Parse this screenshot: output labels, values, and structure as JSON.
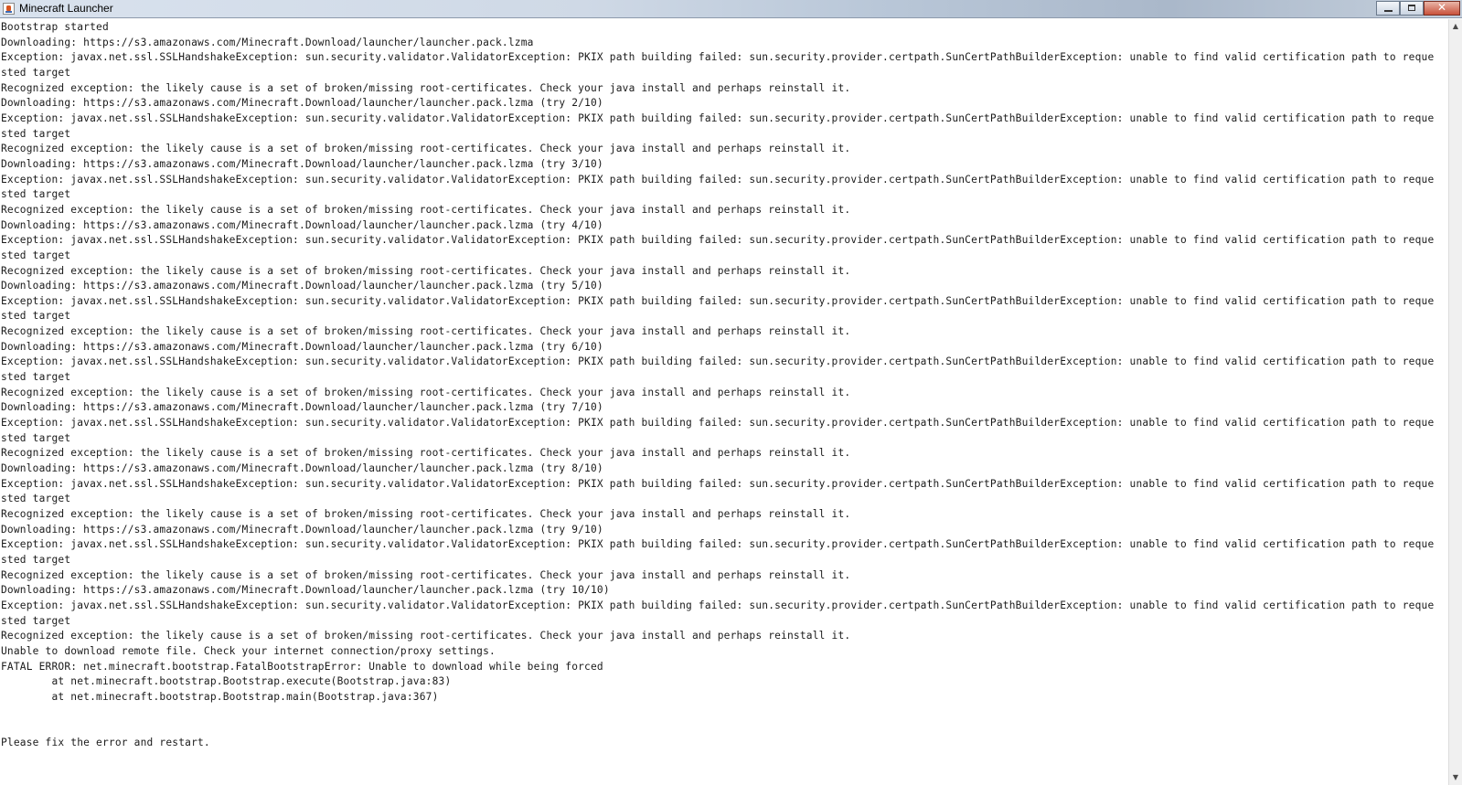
{
  "window": {
    "title": "Minecraft Launcher",
    "close_glyph": "✕"
  },
  "scrollbar": {
    "up_glyph": "▲",
    "down_glyph": "▼"
  },
  "log": {
    "lines": [
      "Bootstrap started",
      "Downloading: https://s3.amazonaws.com/Minecraft.Download/launcher/launcher.pack.lzma",
      "Exception: javax.net.ssl.SSLHandshakeException: sun.security.validator.ValidatorException: PKIX path building failed: sun.security.provider.certpath.SunCertPathBuilderException: unable to find valid certification path to reque",
      "sted target",
      "Recognized exception: the likely cause is a set of broken/missing root-certificates. Check your java install and perhaps reinstall it.",
      "Downloading: https://s3.amazonaws.com/Minecraft.Download/launcher/launcher.pack.lzma (try 2/10)",
      "Exception: javax.net.ssl.SSLHandshakeException: sun.security.validator.ValidatorException: PKIX path building failed: sun.security.provider.certpath.SunCertPathBuilderException: unable to find valid certification path to reque",
      "sted target",
      "Recognized exception: the likely cause is a set of broken/missing root-certificates. Check your java install and perhaps reinstall it.",
      "Downloading: https://s3.amazonaws.com/Minecraft.Download/launcher/launcher.pack.lzma (try 3/10)",
      "Exception: javax.net.ssl.SSLHandshakeException: sun.security.validator.ValidatorException: PKIX path building failed: sun.security.provider.certpath.SunCertPathBuilderException: unable to find valid certification path to reque",
      "sted target",
      "Recognized exception: the likely cause is a set of broken/missing root-certificates. Check your java install and perhaps reinstall it.",
      "Downloading: https://s3.amazonaws.com/Minecraft.Download/launcher/launcher.pack.lzma (try 4/10)",
      "Exception: javax.net.ssl.SSLHandshakeException: sun.security.validator.ValidatorException: PKIX path building failed: sun.security.provider.certpath.SunCertPathBuilderException: unable to find valid certification path to reque",
      "sted target",
      "Recognized exception: the likely cause is a set of broken/missing root-certificates. Check your java install and perhaps reinstall it.",
      "Downloading: https://s3.amazonaws.com/Minecraft.Download/launcher/launcher.pack.lzma (try 5/10)",
      "Exception: javax.net.ssl.SSLHandshakeException: sun.security.validator.ValidatorException: PKIX path building failed: sun.security.provider.certpath.SunCertPathBuilderException: unable to find valid certification path to reque",
      "sted target",
      "Recognized exception: the likely cause is a set of broken/missing root-certificates. Check your java install and perhaps reinstall it.",
      "Downloading: https://s3.amazonaws.com/Minecraft.Download/launcher/launcher.pack.lzma (try 6/10)",
      "Exception: javax.net.ssl.SSLHandshakeException: sun.security.validator.ValidatorException: PKIX path building failed: sun.security.provider.certpath.SunCertPathBuilderException: unable to find valid certification path to reque",
      "sted target",
      "Recognized exception: the likely cause is a set of broken/missing root-certificates. Check your java install and perhaps reinstall it.",
      "Downloading: https://s3.amazonaws.com/Minecraft.Download/launcher/launcher.pack.lzma (try 7/10)",
      "Exception: javax.net.ssl.SSLHandshakeException: sun.security.validator.ValidatorException: PKIX path building failed: sun.security.provider.certpath.SunCertPathBuilderException: unable to find valid certification path to reque",
      "sted target",
      "Recognized exception: the likely cause is a set of broken/missing root-certificates. Check your java install and perhaps reinstall it.",
      "Downloading: https://s3.amazonaws.com/Minecraft.Download/launcher/launcher.pack.lzma (try 8/10)",
      "Exception: javax.net.ssl.SSLHandshakeException: sun.security.validator.ValidatorException: PKIX path building failed: sun.security.provider.certpath.SunCertPathBuilderException: unable to find valid certification path to reque",
      "sted target",
      "Recognized exception: the likely cause is a set of broken/missing root-certificates. Check your java install and perhaps reinstall it.",
      "Downloading: https://s3.amazonaws.com/Minecraft.Download/launcher/launcher.pack.lzma (try 9/10)",
      "Exception: javax.net.ssl.SSLHandshakeException: sun.security.validator.ValidatorException: PKIX path building failed: sun.security.provider.certpath.SunCertPathBuilderException: unable to find valid certification path to reque",
      "sted target",
      "Recognized exception: the likely cause is a set of broken/missing root-certificates. Check your java install and perhaps reinstall it.",
      "Downloading: https://s3.amazonaws.com/Minecraft.Download/launcher/launcher.pack.lzma (try 10/10)",
      "Exception: javax.net.ssl.SSLHandshakeException: sun.security.validator.ValidatorException: PKIX path building failed: sun.security.provider.certpath.SunCertPathBuilderException: unable to find valid certification path to reque",
      "sted target",
      "Recognized exception: the likely cause is a set of broken/missing root-certificates. Check your java install and perhaps reinstall it.",
      "Unable to download remote file. Check your internet connection/proxy settings.",
      "FATAL ERROR: net.minecraft.bootstrap.FatalBootstrapError: Unable to download while being forced",
      "\tat net.minecraft.bootstrap.Bootstrap.execute(Bootstrap.java:83)",
      "\tat net.minecraft.bootstrap.Bootstrap.main(Bootstrap.java:367)",
      "",
      "",
      "Please fix the error and restart."
    ]
  }
}
